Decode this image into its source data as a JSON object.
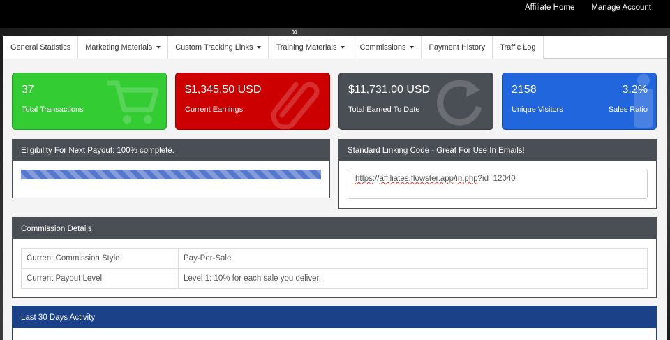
{
  "topnav": {
    "home": "Affiliate Home",
    "account": "Manage Account"
  },
  "divider_glyph": "»",
  "tabs": [
    {
      "label": "General Statistics",
      "dropdown": false
    },
    {
      "label": "Marketing Materials",
      "dropdown": true
    },
    {
      "label": "Custom Tracking Links",
      "dropdown": true
    },
    {
      "label": "Training Materials",
      "dropdown": true
    },
    {
      "label": "Commissions",
      "dropdown": true
    },
    {
      "label": "Payment History",
      "dropdown": false
    },
    {
      "label": "Traffic Log",
      "dropdown": false
    }
  ],
  "stats": {
    "transactions": {
      "value": "37",
      "label": "Total Transactions",
      "color": "#33cc33",
      "icon": "shopping-cart-icon"
    },
    "earnings": {
      "value": "$1,345.50 USD",
      "label": "Current Earnings",
      "color": "#cc0000",
      "icon": "paperclip-icon"
    },
    "total_earned": {
      "value": "$11,731.00 USD",
      "label": "Total Earned To Date",
      "color": "#4a4f55",
      "icon": "refresh-icon"
    },
    "visitors": {
      "value": "2158",
      "label": "Unique Visitors",
      "ratio": "3.2%",
      "ratio_label": "Sales Ratio",
      "color": "#2266dd",
      "icon": "person-icon"
    }
  },
  "payout": {
    "title": "Eligibility For Next Payout: 100% complete.",
    "progress_fraction": 1.0
  },
  "linking": {
    "title": "Standard Linking Code - Great For Use In Emails!",
    "scheme": "https",
    "sep": "://",
    "host": "affiliates.flowster.app",
    "slash": "/",
    "path": "in.php",
    "query": "?id=12040"
  },
  "commission": {
    "title": "Commission Details",
    "rows": [
      {
        "key": "Current Commission Style",
        "value": "Pay-Per-Sale"
      },
      {
        "key": "Current Payout Level",
        "value": "Level 1: 10% for each sale you deliver."
      }
    ]
  },
  "activity": {
    "title": "Last 30 Days Activity"
  }
}
